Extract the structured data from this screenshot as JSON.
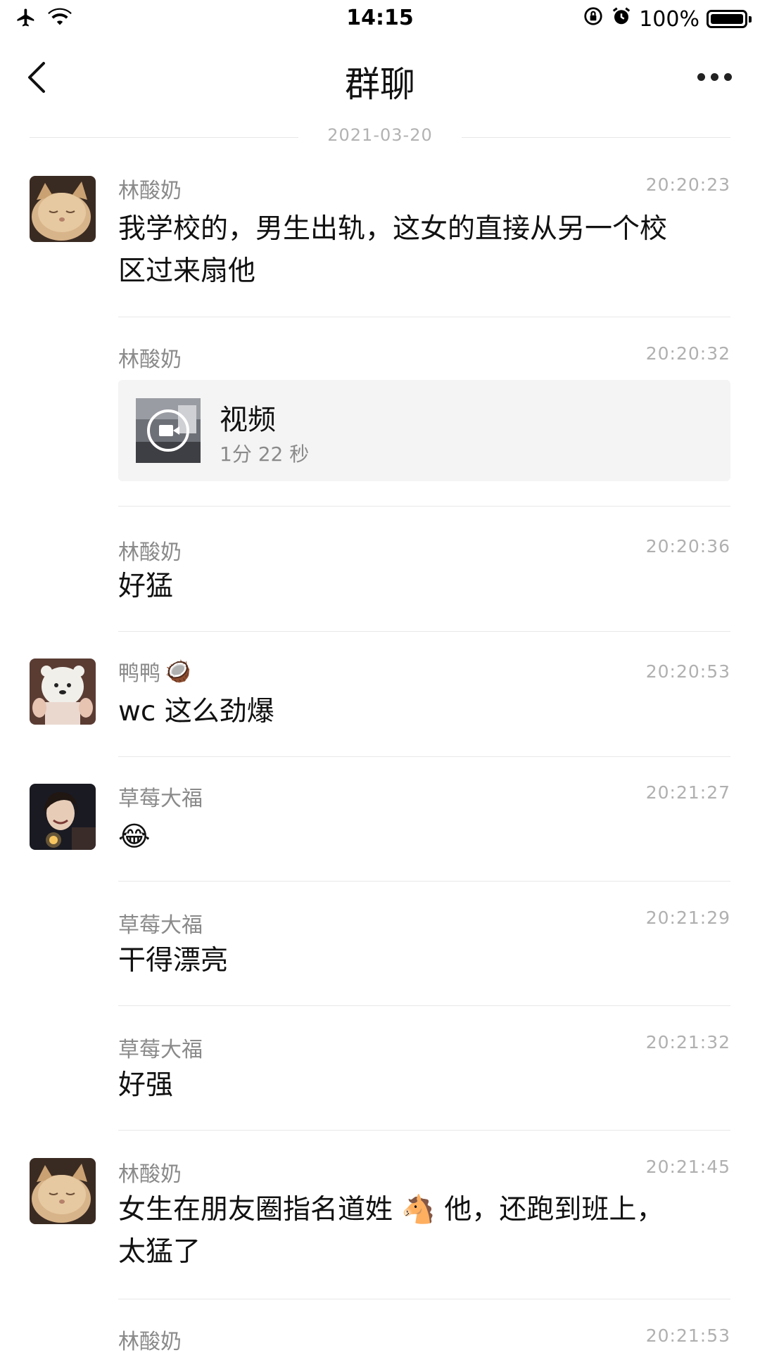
{
  "status_bar": {
    "time": "14:15",
    "battery": "100%",
    "icons": [
      "airplane-icon",
      "wifi-icon",
      "orientation-lock-icon",
      "alarm-icon",
      "battery-icon"
    ]
  },
  "nav": {
    "title": "群聊",
    "back_icon": "chevron-left-icon",
    "more_icon": "more-icon"
  },
  "date_separator": "2021-03-20",
  "messages": [
    {
      "sender": "林酸奶",
      "time": "20:20:23",
      "text_lines": [
        "我学校的，男生出轨，这女的直接从另一个校",
        "区过来扇他"
      ],
      "avatar": "cat-avatar"
    },
    {
      "sender": "林酸奶",
      "time": "20:20:32",
      "video": {
        "title": "视频",
        "duration": "1分 22 秒"
      }
    },
    {
      "sender": "林酸奶",
      "time": "20:20:36",
      "text": "好猛"
    },
    {
      "sender": "鸭鸭",
      "sender_emoji": "🥥",
      "time": "20:20:53",
      "text": "wc 这么劲爆",
      "avatar": "bear-avatar"
    },
    {
      "sender": "草莓大福",
      "time": "20:21:27",
      "text": "😂",
      "avatar": "girl-avatar"
    },
    {
      "sender": "草莓大福",
      "time": "20:21:29",
      "text": "干得漂亮"
    },
    {
      "sender": "草莓大福",
      "time": "20:21:32",
      "text": "好强"
    },
    {
      "sender": "林酸奶",
      "time": "20:21:45",
      "text_lines": [
        "女生在朋友圈指名道姓 🐴 他，还跑到班上，",
        "太猛了"
      ],
      "avatar": "cat-avatar"
    },
    {
      "sender": "林酸奶",
      "time": "20:21:53"
    }
  ],
  "colors": {
    "background": "#ffffff",
    "secondary_text": "#8a8a8a",
    "timestamp": "#b0b0b0",
    "divider": "#e8e8e8",
    "card_background": "#f4f4f4"
  }
}
